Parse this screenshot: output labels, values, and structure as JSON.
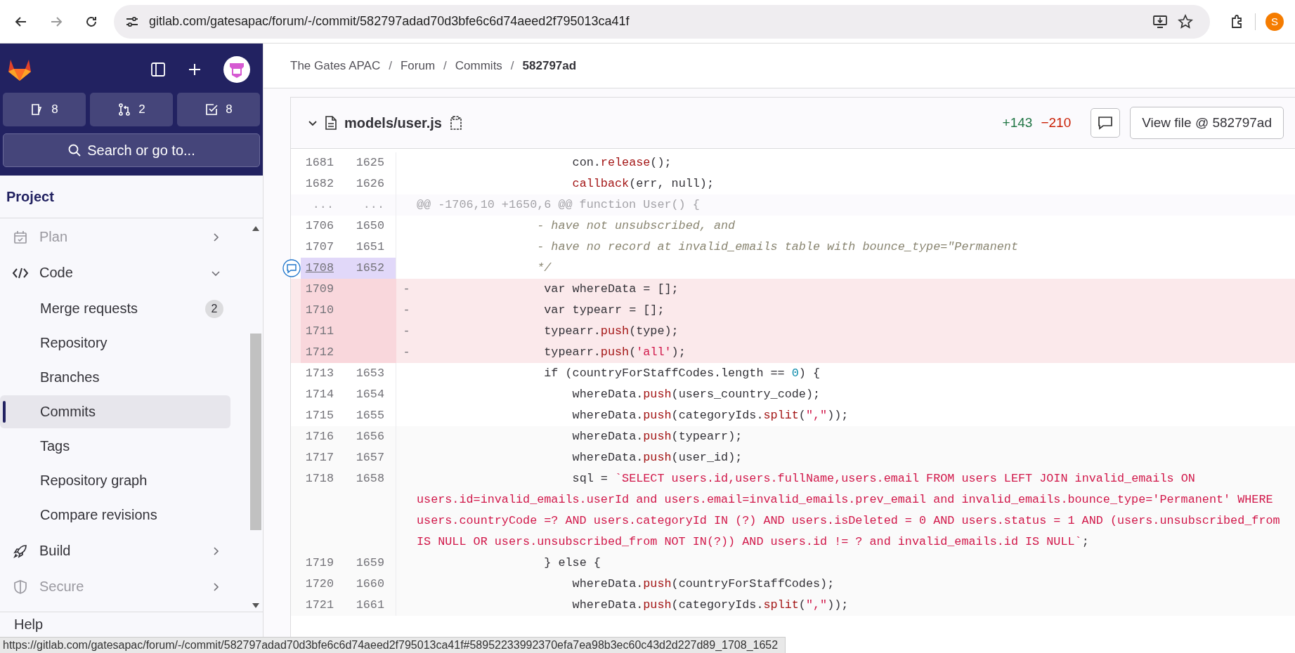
{
  "browser": {
    "url": "gitlab.com/gatesapac/forum/-/commit/582797adad70d3bfe6c6d74aeed2f795013ca41f",
    "profile_initial": "S",
    "status_url": "https://gitlab.com/gatesapac/forum/-/commit/582797adad70d3bfe6c6d74aeed2f795013ca41f#58952233992370efa7ea98b3ec60c43d2d227d89_1708_1652"
  },
  "sidebar": {
    "counters": [
      {
        "kind": "issues",
        "count": "8"
      },
      {
        "kind": "merge_requests",
        "count": "2"
      },
      {
        "kind": "todos",
        "count": "8"
      }
    ],
    "search": {
      "placeholder": "Search or go to..."
    },
    "section_title": "Project",
    "items": [
      {
        "kind": "plan",
        "label": "Plan",
        "dimmed": true,
        "expanded": false
      },
      {
        "kind": "code",
        "label": "Code",
        "dimmed": false,
        "expanded": true,
        "children": [
          {
            "label": "Merge requests",
            "badge": "2",
            "selected": false
          },
          {
            "label": "Repository",
            "selected": false
          },
          {
            "label": "Branches",
            "selected": false
          },
          {
            "label": "Commits",
            "selected": true
          },
          {
            "label": "Tags",
            "selected": false
          },
          {
            "label": "Repository graph",
            "selected": false
          },
          {
            "label": "Compare revisions",
            "selected": false
          }
        ]
      },
      {
        "kind": "build",
        "label": "Build",
        "dimmed": false,
        "expanded": false
      },
      {
        "kind": "secure",
        "label": "Secure",
        "dimmed": true,
        "expanded": false
      }
    ],
    "footer_item": "Help"
  },
  "breadcrumb": {
    "separator": "/",
    "items": [
      {
        "label": "The Gates APAC",
        "current": false
      },
      {
        "label": "Forum",
        "current": false
      },
      {
        "label": "Commits",
        "current": false
      },
      {
        "label": "582797ad",
        "current": true
      }
    ]
  },
  "file": {
    "path": "models/user.js",
    "expanded": true,
    "additions": "+143",
    "deletions": "−210",
    "view_button": "View file @ 582797ad",
    "lines": [
      {
        "kind": "context",
        "old": "1681",
        "new": "1625",
        "tokens": [
          {
            "kind": "plain",
            "t": "                      con."
          },
          {
            "kind": "fn",
            "t": "release"
          },
          {
            "kind": "plain",
            "t": "();"
          }
        ]
      },
      {
        "kind": "context",
        "old": "1682",
        "new": "1626",
        "tokens": [
          {
            "kind": "fn",
            "t": "                      callback"
          },
          {
            "kind": "plain",
            "t": "(err, null);"
          }
        ]
      },
      {
        "kind": "hunk",
        "old": "...",
        "new": "...",
        "tokens": [
          {
            "kind": "meta",
            "t": "@@ -1706,10 +1650,6 @@ function User() {"
          }
        ]
      },
      {
        "kind": "context",
        "old": "1706",
        "new": "1650",
        "tokens": [
          {
            "kind": "comment",
            "t": "                 - have not unsubscribed, and"
          }
        ]
      },
      {
        "kind": "context",
        "old": "1707",
        "new": "1651",
        "tokens": [
          {
            "kind": "comment",
            "t": "                 - have no record at invalid_emails table with bounce_type=\"Permanent"
          }
        ]
      },
      {
        "kind": "highlighted",
        "old": "1708",
        "new": "1652",
        "tokens": [
          {
            "kind": "comment",
            "t": "                 */"
          }
        ]
      },
      {
        "kind": "removed",
        "old": "1709",
        "sign": "-",
        "tokens": [
          {
            "kind": "plain",
            "t": "                  var whereData = [];"
          }
        ]
      },
      {
        "kind": "removed",
        "old": "1710",
        "sign": "-",
        "tokens": [
          {
            "kind": "plain",
            "t": "                  var typearr = [];"
          }
        ]
      },
      {
        "kind": "removed",
        "old": "1711",
        "sign": "-",
        "tokens": [
          {
            "kind": "plain",
            "t": "                  typearr."
          },
          {
            "kind": "fn",
            "t": "push"
          },
          {
            "kind": "plain",
            "t": "(type);"
          }
        ]
      },
      {
        "kind": "removed",
        "old": "1712",
        "sign": "-",
        "tokens": [
          {
            "kind": "plain",
            "t": "                  typearr."
          },
          {
            "kind": "fn",
            "t": "push"
          },
          {
            "kind": "plain",
            "t": "("
          },
          {
            "kind": "str",
            "t": "'all'"
          },
          {
            "kind": "plain",
            "t": ");"
          }
        ]
      },
      {
        "kind": "context",
        "old": "1713",
        "new": "1653",
        "tokens": [
          {
            "kind": "plain",
            "t": "                  if (countryForStaffCodes.length == "
          },
          {
            "kind": "num",
            "t": "0"
          },
          {
            "kind": "plain",
            "t": ") {"
          }
        ]
      },
      {
        "kind": "context",
        "old": "1714",
        "new": "1654",
        "tokens": [
          {
            "kind": "plain",
            "t": "                      whereData."
          },
          {
            "kind": "fn",
            "t": "push"
          },
          {
            "kind": "plain",
            "t": "(users_country_code);"
          }
        ]
      },
      {
        "kind": "context",
        "old": "1715",
        "new": "1655",
        "tokens": [
          {
            "kind": "plain",
            "t": "                      whereData."
          },
          {
            "kind": "fn",
            "t": "push"
          },
          {
            "kind": "plain",
            "t": "(categoryIds."
          },
          {
            "kind": "fn",
            "t": "split"
          },
          {
            "kind": "plain",
            "t": "("
          },
          {
            "kind": "str",
            "t": "\",\""
          },
          {
            "kind": "plain",
            "t": "));"
          }
        ]
      },
      {
        "kind": "expanded",
        "old": "1716",
        "new": "1656",
        "tokens": [
          {
            "kind": "plain",
            "t": "                      whereData."
          },
          {
            "kind": "fn",
            "t": "push"
          },
          {
            "kind": "plain",
            "t": "(typearr);"
          }
        ]
      },
      {
        "kind": "expanded",
        "old": "1717",
        "new": "1657",
        "tokens": [
          {
            "kind": "plain",
            "t": "                      whereData."
          },
          {
            "kind": "fn",
            "t": "push"
          },
          {
            "kind": "plain",
            "t": "(user_id);"
          }
        ]
      },
      {
        "kind": "expanded",
        "old": "1718",
        "new": "1658",
        "tokens": [
          {
            "kind": "plain",
            "t": "                      sql = "
          },
          {
            "kind": "str",
            "t": "`SELECT users.id,users.fullName,users.email FROM users LEFT JOIN invalid_emails ON users.id=invalid_emails.userId and users.email=invalid_emails.prev_email and invalid_emails.bounce_type='Permanent' WHERE users.countryCode =? AND users.categoryId IN (?) AND users.isDeleted = 0 AND users.status = 1 AND (users.unsubscribed_from IS NULL OR users.unsubscribed_from NOT IN(?)) AND users.id != ? and invalid_emails.id IS NULL`"
          },
          {
            "kind": "plain",
            "t": ";"
          }
        ]
      },
      {
        "kind": "expanded",
        "old": "1719",
        "new": "1659",
        "tokens": [
          {
            "kind": "plain",
            "t": "                  } else {"
          }
        ]
      },
      {
        "kind": "expanded",
        "old": "1720",
        "new": "1660",
        "tokens": [
          {
            "kind": "plain",
            "t": "                      whereData."
          },
          {
            "kind": "fn",
            "t": "push"
          },
          {
            "kind": "plain",
            "t": "(countryForStaffCodes);"
          }
        ]
      },
      {
        "kind": "expanded",
        "old": "1721",
        "new": "1661",
        "tokens": [
          {
            "kind": "plain",
            "t": "                      whereData."
          },
          {
            "kind": "fn",
            "t": "push"
          },
          {
            "kind": "plain",
            "t": "(categoryIds."
          },
          {
            "kind": "fn",
            "t": "split"
          },
          {
            "kind": "plain",
            "t": "("
          },
          {
            "kind": "str",
            "t": "\",\""
          },
          {
            "kind": "plain",
            "t": "));"
          }
        ]
      }
    ]
  }
}
